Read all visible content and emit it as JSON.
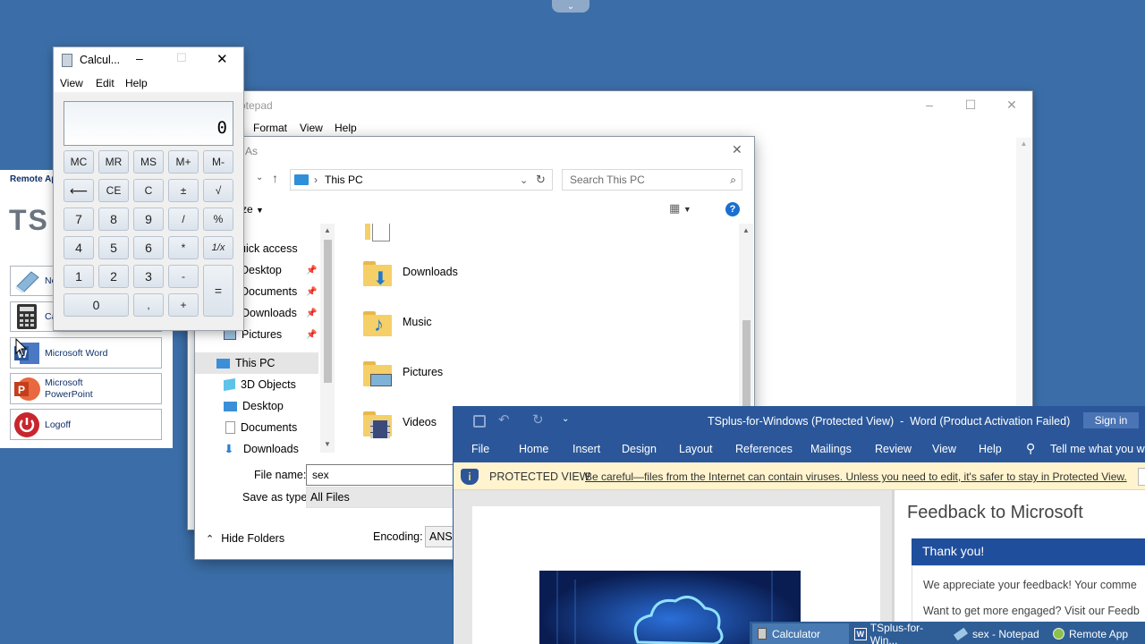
{
  "remote_app": {
    "title": "Remote Ap",
    "logo": "TS",
    "items": [
      {
        "label": "No",
        "icon": "notepad-icon"
      },
      {
        "label": "Ca",
        "icon": "calculator-icon"
      },
      {
        "label": "Microsoft Word",
        "icon": "word-icon"
      },
      {
        "label": "Microsoft\nPowerPoint",
        "icon": "powerpoint-icon"
      },
      {
        "label": "Logoff",
        "icon": "power-icon"
      }
    ]
  },
  "notepad": {
    "title": "Notepad",
    "title_visible": "otepad",
    "menu": [
      "Format",
      "View",
      "Help"
    ]
  },
  "save_dialog": {
    "title": "As",
    "breadcrumb": "This PC",
    "search_placeholder": "Search This PC",
    "organize_label": "ze",
    "nav": [
      {
        "label": "uick access",
        "icon": "star-icon"
      },
      {
        "label": "Desktop",
        "icon": "desktop-icon",
        "pinned": true
      },
      {
        "label": "Documents",
        "icon": "documents-icon",
        "pinned": true
      },
      {
        "label": "Downloads",
        "icon": "downloads-icon",
        "pinned": true
      },
      {
        "label": "Pictures",
        "icon": "pictures-icon",
        "pinned": true
      },
      {
        "label": "This PC",
        "icon": "computer-icon",
        "selected": true
      },
      {
        "label": "3D Objects",
        "icon": "cube-icon"
      },
      {
        "label": "Desktop",
        "icon": "desktop-icon"
      },
      {
        "label": "Documents",
        "icon": "documents-icon"
      },
      {
        "label": "Downloads",
        "icon": "downloads-icon"
      }
    ],
    "files": [
      "Downloads",
      "Music",
      "Pictures",
      "Videos"
    ],
    "file_name_label": "File name:",
    "file_name_value": "sex",
    "save_type_label": "Save as type:",
    "save_type_value": "All Files",
    "hide_folders": "Hide Folders",
    "encoding_label": "Encoding:",
    "encoding_value": "ANSI"
  },
  "calculator": {
    "title": "Calcul...",
    "menu": [
      "View",
      "Edit",
      "Help"
    ],
    "display": "0",
    "memory_keys": [
      "MC",
      "MR",
      "MS",
      "M+",
      "M-"
    ],
    "row2": [
      "⟵",
      "CE",
      "C",
      "±",
      "√"
    ],
    "row3": [
      "7",
      "8",
      "9",
      "/",
      "%"
    ],
    "row4": [
      "4",
      "5",
      "6",
      "*",
      "1/x"
    ],
    "row5": [
      "1",
      "2",
      "3",
      "-"
    ],
    "row6": [
      "0",
      ",",
      "+"
    ],
    "equals": "="
  },
  "word": {
    "title": "TSplus-for-Windows (Protected View)  -  Word (Product Activation Failed)",
    "sign_in": "Sign in",
    "tabs": [
      "File",
      "Home",
      "Insert",
      "Design",
      "Layout",
      "References",
      "Mailings",
      "Review",
      "View",
      "Help"
    ],
    "tell_me": "Tell me what you wa",
    "protected_label": "PROTECTED VIEW",
    "protected_msg": "Be careful—files from the Internet can contain viruses. Unless you need to edit, it's safer to stay in Protected View.",
    "feedback_title": "Feedback to Microsoft",
    "thank_you": "Thank you!",
    "appreciate": "We appreciate your feedback! Your comme",
    "engaged": "Want to get more engaged? Visit our Feedb"
  },
  "taskbar": [
    {
      "label": "Calculator",
      "icon": "calculator-icon"
    },
    {
      "label": "TSplus-for-Win...",
      "icon": "word-icon"
    },
    {
      "label": "sex - Notepad",
      "icon": "notepad-icon"
    },
    {
      "label": "Remote App",
      "icon": "remote-app-icon"
    }
  ],
  "colors": {
    "desktop": "#3b6ea8",
    "word_blue": "#2b579a",
    "protected_yellow": "#fff4ce",
    "feedback_blue": "#1f4e9c"
  }
}
